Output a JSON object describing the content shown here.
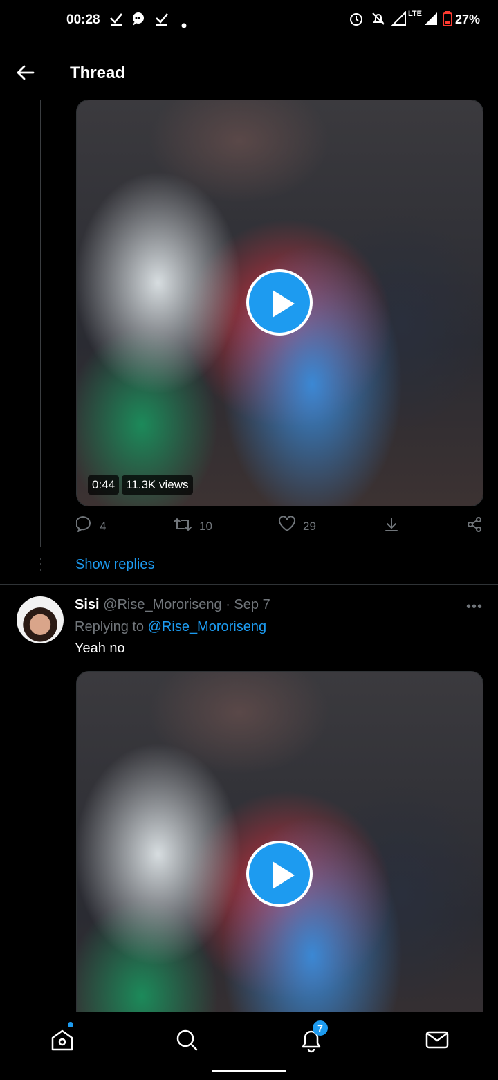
{
  "status_bar": {
    "time": "00:28",
    "network": "LTE",
    "battery": "27%",
    "icons": [
      "check-icon",
      "chat-icon",
      "check-icon",
      "dot-icon",
      "alarm-icon",
      "mute-icon",
      "signal-icon",
      "signal-icon",
      "battery-low-icon"
    ]
  },
  "header": {
    "title": "Thread",
    "back_icon": "arrow-left-icon"
  },
  "tweet": {
    "video": {
      "duration": "0:44",
      "views": "11.3K views"
    },
    "actions": {
      "replies": "4",
      "retweets": "10",
      "likes": "29"
    }
  },
  "show_replies_label": "Show replies",
  "reply": {
    "name": "Sisi",
    "handle": "@Rise_Mororiseng",
    "separator": "·",
    "date": "Sep 7",
    "replying_prefix": "Replying to",
    "replying_handle": "@Rise_Mororiseng",
    "text": "Yeah no",
    "more": "•••"
  },
  "bottom_nav": {
    "items": [
      "home-icon",
      "search-icon",
      "notifications-icon",
      "messages-icon"
    ],
    "notifications_badge": "7"
  },
  "colors": {
    "accent": "#1d9bf0",
    "background": "#000000",
    "muted": "#71767b",
    "divider": "#2f3336"
  }
}
